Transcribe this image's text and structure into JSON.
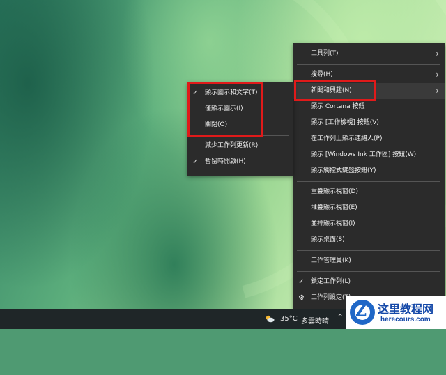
{
  "main_menu": {
    "items": [
      {
        "label": "工具列(T)",
        "arrow": true
      },
      {
        "label": "搜尋(H)",
        "arrow": true
      },
      {
        "label": "新聞和興趣(N)",
        "arrow": true
      },
      {
        "label": "顯示 Cortana 按鈕"
      },
      {
        "label": "顯示 [工作檢視] 按鈕(V)"
      },
      {
        "label": "在工作列上顯示連絡人(P)"
      },
      {
        "label": "顯示 [Windows Ink 工作區] 按鈕(W)"
      },
      {
        "label": "顯示觸控式鍵盤按鈕(Y)"
      },
      {
        "label": "重疊顯示視窗(D)"
      },
      {
        "label": "堆疊顯示視窗(E)"
      },
      {
        "label": "並排顯示視窗(I)"
      },
      {
        "label": "顯示桌面(S)"
      },
      {
        "label": "工作管理員(K)"
      },
      {
        "label": "鎖定工作列(L)",
        "checked": true
      },
      {
        "label": "工作列設定(T)",
        "icon": "gear-icon"
      }
    ]
  },
  "sub_menu": {
    "items": [
      {
        "label": "顯示圖示和文字(T)",
        "checked": true
      },
      {
        "label": "僅顯示圖示(I)"
      },
      {
        "label": "關閉(O)"
      },
      {
        "label": "減少工作列更新(R)"
      },
      {
        "label": "暫留時開啟(H)",
        "checked": true
      }
    ]
  },
  "taskbar": {
    "weather_icon": "partly-cloudy-icon",
    "temperature": "35°C",
    "weather_desc": "多雲時晴",
    "tray_arrow": "^"
  },
  "watermark": {
    "z_letter": "Z",
    "title": "这里教程网",
    "url": "herecours.com"
  },
  "colors": {
    "menu_bg": "#2b2b2b",
    "highlight_box": "#e01a1a",
    "taskbar_bg": "#1f2628"
  }
}
